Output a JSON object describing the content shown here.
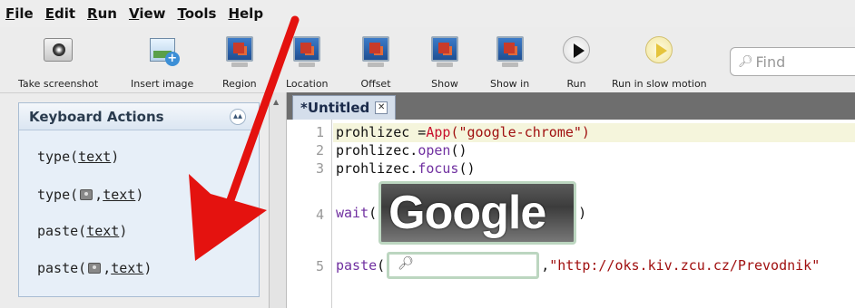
{
  "menubar": {
    "items": [
      {
        "first": "F",
        "rest": "ile"
      },
      {
        "first": "E",
        "rest": "dit"
      },
      {
        "first": "R",
        "rest": "un"
      },
      {
        "first": "V",
        "rest": "iew"
      },
      {
        "first": "T",
        "rest": "ools"
      },
      {
        "first": "H",
        "rest": "elp"
      }
    ]
  },
  "toolbar": {
    "take_screenshot": "Take screenshot",
    "insert_image": "Insert image",
    "region": "Region",
    "location": "Location",
    "offset": "Offset",
    "show": "Show",
    "show_in": "Show in",
    "run": "Run",
    "run_slow": "Run in slow motion",
    "find_placeholder": "Find"
  },
  "left_panel": {
    "title": "Keyboard Actions",
    "actions": [
      {
        "pre": "type( ",
        "arg": "text",
        "post": " )"
      },
      {
        "pre": "type( ",
        "mid": " , ",
        "arg": "text",
        "post": " )"
      },
      {
        "pre": "paste( ",
        "arg": "text",
        "post": " )"
      },
      {
        "pre": "paste( ",
        "mid": " , ",
        "arg": "text",
        "post": " )"
      }
    ]
  },
  "editor": {
    "tab_label": "*Untitled",
    "lines": [
      {
        "num": "1",
        "a": "prohlizec = ",
        "b": "App",
        "c": "(\"google-chrome\")"
      },
      {
        "num": "2",
        "a": "prohlizec.",
        "b": "open",
        "c": "()"
      },
      {
        "num": "3",
        "a": "prohlizec.",
        "b": "focus",
        "c": "()"
      },
      {
        "num": "4",
        "a": "wait",
        "b": "(",
        "c": ")"
      },
      {
        "num": "5",
        "a": "paste",
        "b": "(",
        "c": ", ",
        "d": "\"http://oks.kiv.zcu.cz/Prevodnik\""
      }
    ],
    "image_text": "Google"
  }
}
